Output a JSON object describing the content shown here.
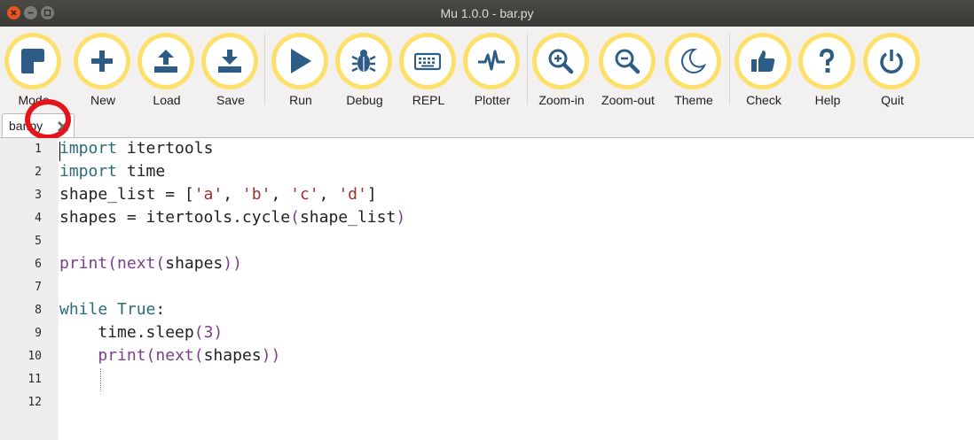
{
  "window": {
    "title": "Mu 1.0.0 - bar.py"
  },
  "toolbar": {
    "buttons": [
      {
        "label": "Mode",
        "icon": "mode-icon"
      },
      {
        "label": "New",
        "icon": "plus-icon"
      },
      {
        "label": "Load",
        "icon": "upload-icon"
      },
      {
        "label": "Save",
        "icon": "download-icon"
      },
      {
        "label": "Run",
        "icon": "play-icon"
      },
      {
        "label": "Debug",
        "icon": "bug-icon"
      },
      {
        "label": "REPL",
        "icon": "keyboard-icon"
      },
      {
        "label": "Plotter",
        "icon": "pulse-icon"
      },
      {
        "label": "Zoom-in",
        "icon": "zoom-in-icon"
      },
      {
        "label": "Zoom-out",
        "icon": "zoom-out-icon"
      },
      {
        "label": "Theme",
        "icon": "moon-icon"
      },
      {
        "label": "Check",
        "icon": "thumbs-up-icon"
      },
      {
        "label": "Help",
        "icon": "question-icon"
      },
      {
        "label": "Quit",
        "icon": "power-icon"
      }
    ],
    "accent_color": "#fde06a"
  },
  "tabs": [
    {
      "name": "bar.py",
      "close_icon": "close-icon"
    }
  ],
  "editor": {
    "line_numbers": [
      "1",
      "2",
      "3",
      "4",
      "5",
      "6",
      "7",
      "8",
      "9",
      "10",
      "11",
      "12"
    ],
    "lines": [
      "import itertools",
      "import time",
      "shape_list = ['a', 'b', 'c', 'd']",
      "shapes = itertools.cycle(shape_list)",
      "",
      "print(next(shapes))",
      "",
      "while True:",
      "    time.sleep(3)",
      "    print(next(shapes))",
      "",
      ""
    ]
  },
  "colors": {
    "keyword": "#2b6c78",
    "builtin": "#7b3f8c",
    "string": "#a52d2d",
    "highlight": "#e4141b"
  }
}
